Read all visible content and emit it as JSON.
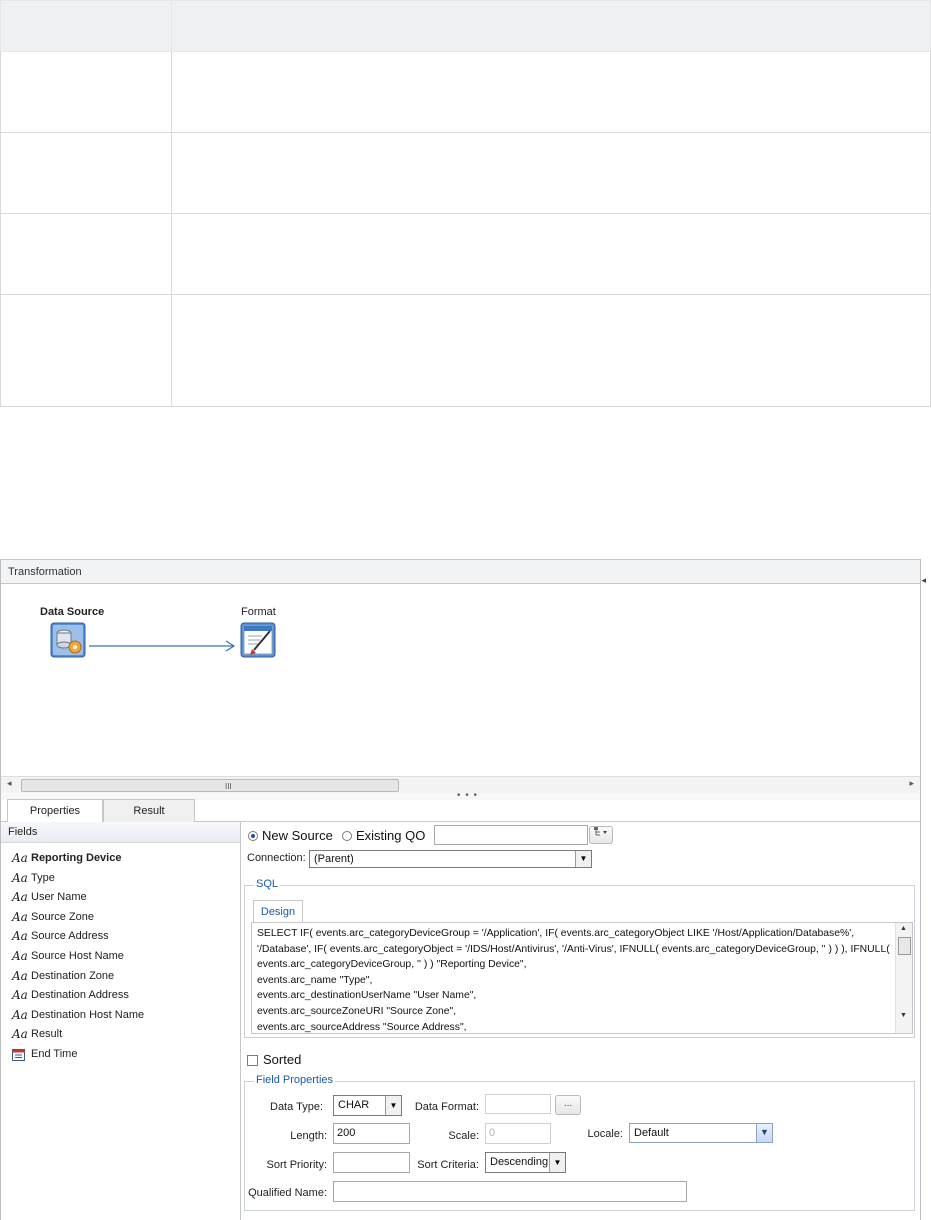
{
  "top_table": {
    "rows": 5
  },
  "panel": {
    "title": "Transformation",
    "collapse_glyph": "◂"
  },
  "canvas": {
    "nodes": [
      {
        "label": "Data Source",
        "icon": "database-gear-icon",
        "bold": true
      },
      {
        "label": "Format",
        "icon": "format-brush-icon",
        "bold": false
      }
    ],
    "scroll_grip": "III"
  },
  "splitter_glyph": "• • •",
  "tabs": [
    {
      "label": "Properties",
      "active": true
    },
    {
      "label": "Result",
      "active": false
    }
  ],
  "fields": {
    "header": "Fields",
    "items": [
      {
        "label": "Reporting Device",
        "icon": "text-field-icon"
      },
      {
        "label": "Type",
        "icon": "text-field-icon"
      },
      {
        "label": "User Name",
        "icon": "text-field-icon"
      },
      {
        "label": "Source Zone",
        "icon": "text-field-icon"
      },
      {
        "label": "Source Address",
        "icon": "text-field-icon"
      },
      {
        "label": "Source Host Name",
        "icon": "text-field-icon"
      },
      {
        "label": "Destination Zone",
        "icon": "text-field-icon"
      },
      {
        "label": "Destination Address",
        "icon": "text-field-icon"
      },
      {
        "label": "Destination Host Name",
        "icon": "text-field-icon"
      },
      {
        "label": "Result",
        "icon": "text-field-icon"
      },
      {
        "label": "End Time",
        "icon": "calendar-icon"
      }
    ],
    "text_icon_glyph": "Aa"
  },
  "source": {
    "new_source_label": "New Source",
    "existing_qo_label": "Existing QO",
    "selected": "new",
    "existing_qo_value": "",
    "connection_label": "Connection:",
    "connection_value": "(Parent)"
  },
  "sql": {
    "legend": "SQL",
    "tab": "Design",
    "lines": [
      "SELECT IF( events.arc_categoryDeviceGroup = '/Application', IF( events.arc_categoryObject LIKE '/Host/Application/Database%',",
      "'/Database', IF( events.arc_categoryObject = '/IDS/Host/Antivirus', '/Anti-Virus', IFNULL( events.arc_categoryDeviceGroup, '' ) ) ), IFNULL(",
      "events.arc_categoryDeviceGroup, '' ) ) \"Reporting Device\",",
      "   events.arc_name \"Type\",",
      "   events.arc_destinationUserName \"User Name\",",
      "   events.arc_sourceZoneURI \"Source Zone\",",
      "   events.arc_sourceAddress \"Source Address\","
    ]
  },
  "sorted": {
    "label": "Sorted",
    "checked": false
  },
  "field_properties": {
    "legend": "Field Properties",
    "data_type_label": "Data Type:",
    "data_type_value": "CHAR",
    "data_format_label": "Data Format:",
    "data_format_value": "",
    "data_format_button": "...",
    "length_label": "Length:",
    "length_value": "200",
    "scale_label": "Scale:",
    "scale_value": "0",
    "locale_label": "Locale:",
    "locale_value": "Default",
    "sort_priority_label": "Sort Priority:",
    "sort_priority_value": "",
    "sort_criteria_label": "Sort Criteria:",
    "sort_criteria_value": "Descending",
    "qualified_name_label": "Qualified Name:",
    "qualified_name_value": ""
  },
  "colors": {
    "accent": "#1a5aa8",
    "panel_header": "#f1f3f5",
    "table_header": "#eef0f2"
  }
}
